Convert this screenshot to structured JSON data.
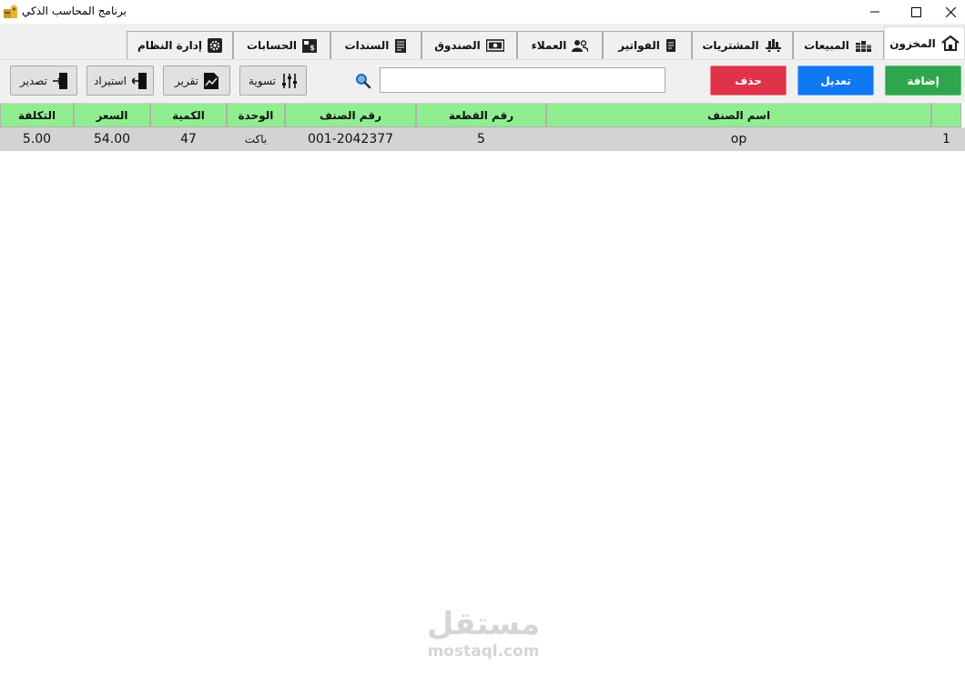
{
  "window": {
    "title": "برنامج المحاسب الذكي",
    "icon": "app-logo-icon"
  },
  "tabs": [
    {
      "label": "المخزون",
      "icon": "warehouse-icon",
      "active": true
    },
    {
      "label": "المبيعات",
      "icon": "coins-icon",
      "active": false
    },
    {
      "label": "المشتريات",
      "icon": "cart-icon",
      "active": false
    },
    {
      "label": "الفواتير",
      "icon": "invoice-icon",
      "active": false
    },
    {
      "label": "العملاء",
      "icon": "users-icon",
      "active": false
    },
    {
      "label": "الصندوق",
      "icon": "cash-icon",
      "active": false
    },
    {
      "label": "السندات",
      "icon": "document-icon",
      "active": false
    },
    {
      "label": "الحسابات",
      "icon": "accounts-icon",
      "active": false
    },
    {
      "label": "إدارة النظام",
      "icon": "gear-icon",
      "active": false
    }
  ],
  "toolbar": {
    "add_label": "إضافة",
    "edit_label": "تعديل",
    "delete_label": "حذف",
    "settle_label": "تسوية",
    "report_label": "تقرير",
    "import_label": "استيراد",
    "export_label": "تصدير",
    "search_value": "",
    "colors": {
      "add": "#2ea64d",
      "edit": "#1178f5",
      "delete": "#e0334a"
    }
  },
  "grid": {
    "header_color": "#90ee90",
    "columns": [
      "اسم الصنف",
      "رقم القطعة",
      "رقم الصنف",
      "الوحدة",
      "الكمية",
      "السعر",
      "التكلفة"
    ],
    "rows": [
      {
        "num": "1",
        "name": "op",
        "part_no": "5",
        "item_no": "001-2042377",
        "unit": "باكت",
        "qty": "47",
        "price": "54.00",
        "cost": "5.00"
      }
    ]
  },
  "watermark": {
    "arabic": "مستقل",
    "latin": "mostaql.com"
  }
}
